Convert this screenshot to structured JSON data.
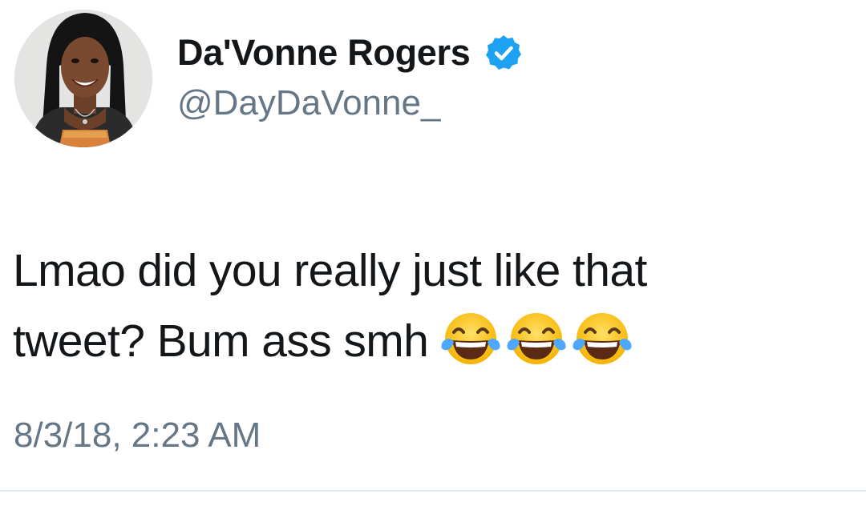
{
  "author": {
    "display_name": "Da'Vonne Rogers",
    "handle": "@DayDaVonne_",
    "verified": true,
    "verified_icon": "verified-badge-icon",
    "verified_color": "#1da1f2"
  },
  "tweet": {
    "text_line_1": "Lmao did you really just like that",
    "text_line_2": "tweet? Bum ass smh",
    "emojis": [
      "face-with-tears-of-joy",
      "face-with-tears-of-joy",
      "face-with-tears-of-joy"
    ],
    "timestamp": "8/3/18, 2:23 AM"
  },
  "colors": {
    "text_primary": "#14171a",
    "text_secondary": "#657786",
    "divider": "#e1e8ed"
  }
}
